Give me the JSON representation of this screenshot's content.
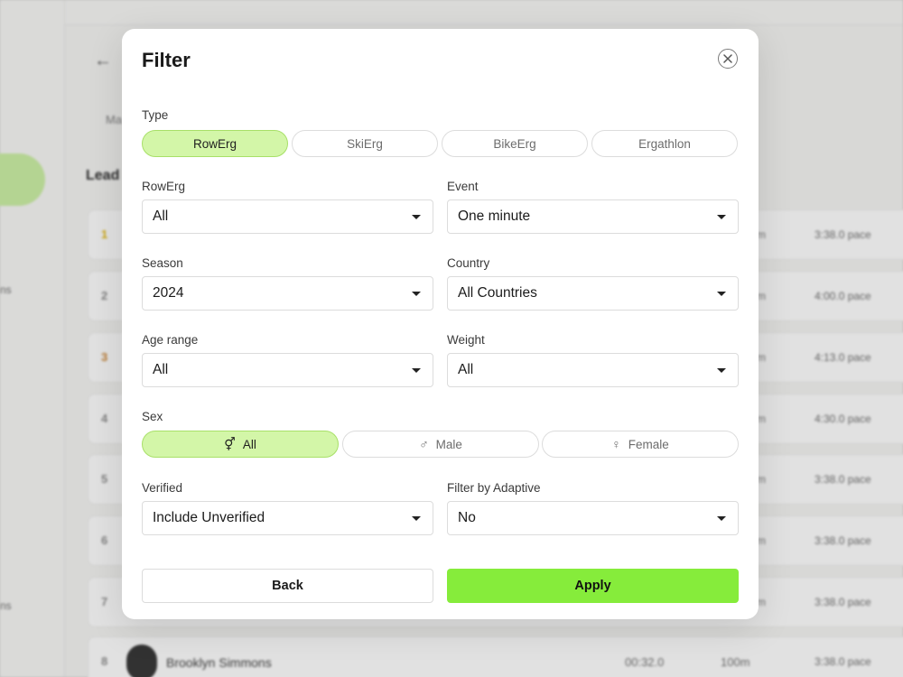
{
  "background": {
    "sidebar_items": [
      "ns",
      "ns"
    ],
    "tab": "Ma",
    "heading": "Lead",
    "rows": [
      {
        "rank": "1",
        "rank_style": "gold",
        "m": "m",
        "pace": "3:38.0 pace"
      },
      {
        "rank": "2",
        "rank_style": "",
        "m": "m",
        "pace": "4:00.0 pace"
      },
      {
        "rank": "3",
        "rank_style": "bronze",
        "m": "m",
        "pace": "4:13.0 pace"
      },
      {
        "rank": "4",
        "rank_style": "",
        "m": "m",
        "pace": "4:30.0 pace"
      },
      {
        "rank": "5",
        "rank_style": "",
        "m": "m",
        "pace": "3:38.0 pace"
      },
      {
        "rank": "6",
        "rank_style": "",
        "m": "m",
        "pace": "3:38.0 pace"
      },
      {
        "rank": "7",
        "rank_style": "",
        "m": "m",
        "pace": "3:38.0 pace"
      }
    ],
    "last_row": {
      "rank": "8",
      "name": "Brooklyn Simmons",
      "time": "00:32.0",
      "distance": "100m",
      "pace": "3:38.0 pace"
    }
  },
  "modal": {
    "title": "Filter",
    "type": {
      "label": "Type",
      "options": [
        "RowErg",
        "SkiErg",
        "BikeErg",
        "Ergathlon"
      ],
      "selected": "RowErg"
    },
    "rowerg": {
      "label": "RowErg",
      "value": "All"
    },
    "event": {
      "label": "Event",
      "value": "One minute"
    },
    "season": {
      "label": "Season",
      "value": "2024"
    },
    "country": {
      "label": "Country",
      "value": "All Countries"
    },
    "age_range": {
      "label": "Age range",
      "value": "All"
    },
    "weight": {
      "label": "Weight",
      "value": "All"
    },
    "sex": {
      "label": "Sex",
      "options": [
        {
          "label": "All",
          "icon": "gender-all-icon",
          "glyph": "⚥"
        },
        {
          "label": "Male",
          "icon": "male-icon",
          "glyph": "♂"
        },
        {
          "label": "Female",
          "icon": "female-icon",
          "glyph": "♀"
        }
      ],
      "selected": "All"
    },
    "verified": {
      "label": "Verified",
      "value": "Include Unverified"
    },
    "adaptive": {
      "label": "Filter by Adaptive",
      "value": "No"
    },
    "back_label": "Back",
    "apply_label": "Apply"
  },
  "colors": {
    "accent": "#86ec3b",
    "selected_fill": "#d3f6a8",
    "selected_border": "#a8e068"
  }
}
